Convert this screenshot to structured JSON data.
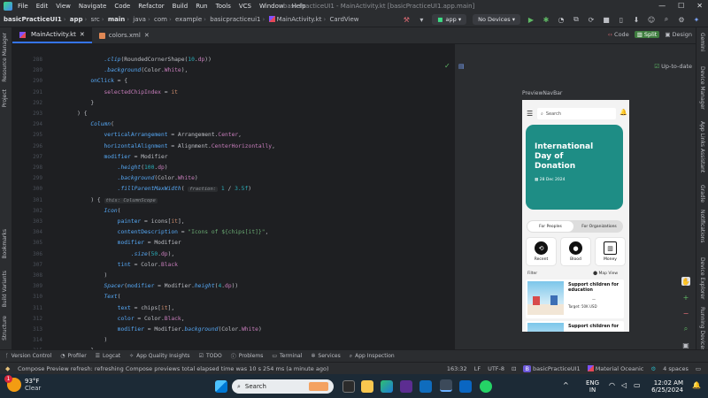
{
  "menu": {
    "items": [
      "File",
      "Edit",
      "View",
      "Navigate",
      "Code",
      "Refactor",
      "Build",
      "Run",
      "Tools",
      "VCS",
      "Window",
      "Help"
    ],
    "window_title": "basicPracticeUI1 - MainActivity.kt [basicPracticeUI1.app.main]"
  },
  "toolbar": {
    "breadcrumb": [
      "basicPracticeUI1",
      "app",
      "src",
      "main",
      "java",
      "com",
      "example",
      "basicpracticeui1",
      "MainActivity.kt",
      "CardView"
    ],
    "run_config": "app",
    "devices": "No Devices"
  },
  "left_strip": [
    "Resource Manager",
    "Project",
    "Bookmarks",
    "Build Variants",
    "Structure"
  ],
  "right_strip": [
    "Gemini",
    "Device Manager",
    "App Links Assistant",
    "Gradle",
    "Notifications",
    "Device Explorer",
    "Running Devices"
  ],
  "tabs": [
    {
      "label": "MainActivity.kt",
      "type": "kt",
      "active": true
    },
    {
      "label": "colors.xml",
      "type": "xml",
      "active": false
    }
  ],
  "code_lines": [
    {
      "n": "288",
      "html": "            <span class='fn'>.clip</span>(<span class='cls'>RoundedCornerShape</span>(<span class='num'>10</span>.<span class='prop'>dp</span>))"
    },
    {
      "n": "289",
      "html": "            <span class='fn'>.background</span>(Color.<span class='prop'>White</span>),"
    },
    {
      "n": "290",
      "html": "        <span class='named'>onClick</span> = {"
    },
    {
      "n": "291",
      "html": "            <span class='lam'>selectedChipIndex</span> = <span class='kw'>it</span>"
    },
    {
      "n": "292",
      "html": "        }"
    },
    {
      "n": "293",
      "html": "    ) {"
    },
    {
      "n": "294",
      "html": "        <span class='fn'>Column</span>("
    },
    {
      "n": "295",
      "html": "            <span class='named'>verticalArrangement</span> = Arrangement.<span class='prop'>Center</span>,"
    },
    {
      "n": "296",
      "html": "            <span class='named'>horizontalAlignment</span> = Alignment.<span class='prop'>CenterHorizontally</span>,"
    },
    {
      "n": "297",
      "html": "            <span class='named'>modifier</span> = Modifier"
    },
    {
      "n": "298",
      "html": "                <span class='fn'>.height</span>(<span class='num'>100</span>.<span class='prop'>dp</span>)"
    },
    {
      "n": "299",
      "html": "                <span class='fn'>.background</span>(Color.<span class='prop'>White</span>)"
    },
    {
      "n": "300",
      "html": "                <span class='fn'>.fillParentMaxWidth</span>( <span class='hint'>fraction:</span> <span class='num'>1</span> / <span class='num'>3.5f</span>)"
    },
    {
      "n": "301",
      "html": "        ) { <span class='hint'>this: ColumnScope</span>"
    },
    {
      "n": "302",
      "html": "            <span class='fn'>Icon</span>("
    },
    {
      "n": "303",
      "html": "                <span class='named'>painter</span> = icons[<span class='kw'>it</span>],"
    },
    {
      "n": "304",
      "html": "                <span class='named'>contentDescription</span> = <span class='str'>\"Icons of ${chips[it]}\"</span>,"
    },
    {
      "n": "305",
      "html": "                <span class='named'>modifier</span> = Modifier"
    },
    {
      "n": "306",
      "html": "                    <span class='fn'>.size</span>(<span class='num'>50</span>.<span class='prop'>dp</span>),"
    },
    {
      "n": "307",
      "html": "                <span class='named'>tint</span> = Color.<span class='prop'>Black</span>"
    },
    {
      "n": "308",
      "html": "            )"
    },
    {
      "n": "309",
      "html": "            <span class='fn'>Spacer</span>(<span class='named'>modifier</span> = Modifier.<span class='fn'>height</span>(<span class='num'>4</span>.<span class='prop'>dp</span>))"
    },
    {
      "n": "310",
      "html": "            <span class='fn'>Text</span>("
    },
    {
      "n": "311",
      "html": "                <span class='named'>text</span> = chips[<span class='kw'>it</span>],"
    },
    {
      "n": "312",
      "html": "                <span class='named'>color</span> = Color.<span class='prop'>Black</span>,"
    },
    {
      "n": "313",
      "html": "                <span class='named'>modifier</span> = Modifier.<span class='fn'>background</span>(Color.<span class='prop'>White</span>)"
    },
    {
      "n": "314",
      "html": "            )"
    },
    {
      "n": "315",
      "html": "        }"
    }
  ],
  "preview": {
    "modes": [
      "Code",
      "Split",
      "Design"
    ],
    "status": "Up-to-date",
    "name": "PreviewNavBar",
    "search_placeholder": "Search",
    "hero_title": "International Day of Donation",
    "hero_date": "28 Dec 2024",
    "segments": [
      "For Peoples",
      "For Organizations"
    ],
    "chips": [
      {
        "label": "Recent",
        "icon": "⟲"
      },
      {
        "label": "Blood",
        "icon": "💧"
      },
      {
        "label": "Money",
        "icon": "💳"
      }
    ],
    "filter_label": "Filter",
    "map_label": "Map View",
    "event_title": "Support children for education",
    "event_title2": "Support children for",
    "event_target": "Target: 50K USD",
    "event_dash": "—"
  },
  "bottom_tools": [
    "Version Control",
    "Profiler",
    "Logcat",
    "App Quality Insights",
    "TODO",
    "Problems",
    "Terminal",
    "Services",
    "App Inspection"
  ],
  "status": {
    "message": "Compose Preview refresh: refreshing Compose previews total elapsed time was 10 s 254 ms (a minute ago)",
    "position": "163:32",
    "line_sep": "LF",
    "encoding": "UTF-8",
    "project": "basicPracticeUI1",
    "theme": "Material Oceanic",
    "indent": "4 spaces"
  },
  "taskbar": {
    "weather_temp": "93°F",
    "weather_desc": "Clear",
    "search": "Search",
    "lang1": "ENG",
    "lang2": "IN",
    "time": "12:02 AM",
    "date": "6/25/2024",
    "badge": "1"
  }
}
